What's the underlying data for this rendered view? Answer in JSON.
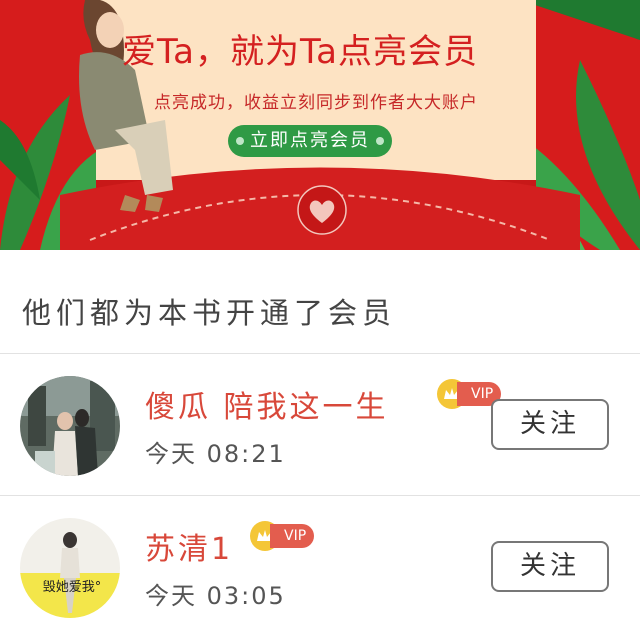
{
  "banner": {
    "headline": "爱Ta，就为Ta点亮会员",
    "subline": "点亮成功，收益立刻同步到作者大大账户",
    "cta_label": "立即点亮会员"
  },
  "section": {
    "title": "他们都为本书开通了会员"
  },
  "members": [
    {
      "name": "傻瓜 陪我这一生",
      "badge": "VIP",
      "time": "今天 08:21",
      "follow_label": "关注"
    },
    {
      "name": "苏清1",
      "badge": "VIP",
      "time": "今天 03:05",
      "follow_label": "关注",
      "avatar_caption": "毁她爱我°"
    }
  ],
  "colors": {
    "banner_red": "#d61c1c",
    "cta_green": "#2f9a45",
    "name_red": "#d8483a",
    "vip_red": "#e35d4e",
    "crown_gold": "#f4c637"
  }
}
